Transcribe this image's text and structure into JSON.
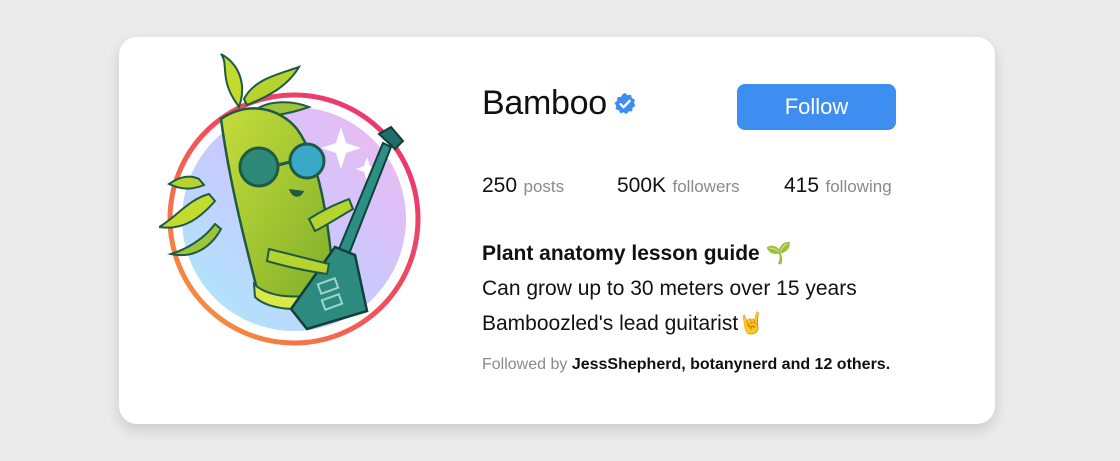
{
  "profile": {
    "username": "Bamboo",
    "verified": true,
    "follow_label": "Follow",
    "accent_color": "#3d8ef0"
  },
  "stats": {
    "posts": {
      "value": "250",
      "label": "posts"
    },
    "followers": {
      "value": "500K",
      "label": "followers"
    },
    "following": {
      "value": "415",
      "label": "following"
    }
  },
  "bio": {
    "title": "Plant anatomy lesson guide 🌱",
    "line1": "Can grow up to 30 meters over 15 years",
    "line2": "Bamboozled's lead guitarist🤘"
  },
  "followed_by": {
    "prefix": "Followed by",
    "names": "JessShepherd, botanynerd and 12 others."
  },
  "icons": {
    "verified": "verified-badge-icon",
    "avatar": "bamboo-guitarist-illustration"
  }
}
